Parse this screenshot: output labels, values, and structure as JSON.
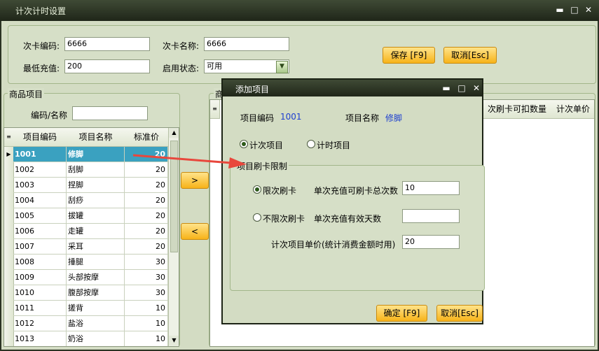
{
  "window": {
    "title": "计次计时设置",
    "minimize": "▬",
    "maximize": "□",
    "close": "✕"
  },
  "form": {
    "card_code_label": "次卡编码:",
    "card_code_value": "6666",
    "card_name_label": "次卡名称:",
    "card_name_value": "6666",
    "min_recharge_label": "最低充值:",
    "min_recharge_value": "200",
    "status_label": "启用状态:",
    "status_value": "可用",
    "save_button": "保存 [F9]",
    "cancel_button": "取消[Esc]"
  },
  "products": {
    "legend": "商品项目",
    "search_label": "编码/名称",
    "columns": [
      "项目编码",
      "项目名称",
      "标准价"
    ],
    "rows": [
      {
        "code": "1001",
        "name": "修脚",
        "price": "20"
      },
      {
        "code": "1002",
        "name": "刮脚",
        "price": "20"
      },
      {
        "code": "1003",
        "name": "捏脚",
        "price": "20"
      },
      {
        "code": "1004",
        "name": "刮痧",
        "price": "20"
      },
      {
        "code": "1005",
        "name": "拔罐",
        "price": "20"
      },
      {
        "code": "1006",
        "name": "走罐",
        "price": "20"
      },
      {
        "code": "1007",
        "name": "采耳",
        "price": "20"
      },
      {
        "code": "1008",
        "name": "捶腿",
        "price": "30"
      },
      {
        "code": "1009",
        "name": "头部按摩",
        "price": "30"
      },
      {
        "code": "1010",
        "name": "腹部按摩",
        "price": "30"
      },
      {
        "code": "1011",
        "name": "搓背",
        "price": "10"
      },
      {
        "code": "1012",
        "name": "盐浴",
        "price": "10"
      },
      {
        "code": "1013",
        "name": "奶浴",
        "price": "10"
      }
    ]
  },
  "transfer": {
    "add": ">",
    "remove": "<"
  },
  "right_panel": {
    "legend_partial": "商",
    "columns": [
      "次刷卡可扣数量",
      "计次单价"
    ]
  },
  "dialog": {
    "title": "添加项目",
    "code_label": "项目编码",
    "code_value": "1001",
    "name_label": "项目名称",
    "name_value": "修脚",
    "mode_count": "计次项目",
    "mode_time": "计时项目",
    "limit_legend": "项目刷卡限制",
    "limited": "限次刷卡",
    "limited_field_label": "单次充值可刷卡总次数",
    "limited_field_value": "10",
    "unlimited": "不限次刷卡",
    "unlimited_field_label": "单次充值有效天数",
    "unlimited_field_value": "",
    "unit_price_label": "计次项目单价(统计消费金额时用)",
    "unit_price_value": "20",
    "ok_button": "确定 [F9]",
    "cancel_button": "取消[Esc]"
  },
  "colors": {
    "title_bar": "#2a3322",
    "selected_row": "#3aa1c0",
    "button_orange": "#f7b319",
    "arrow": "#e8473c",
    "code_blue": "#1d3fd0"
  }
}
